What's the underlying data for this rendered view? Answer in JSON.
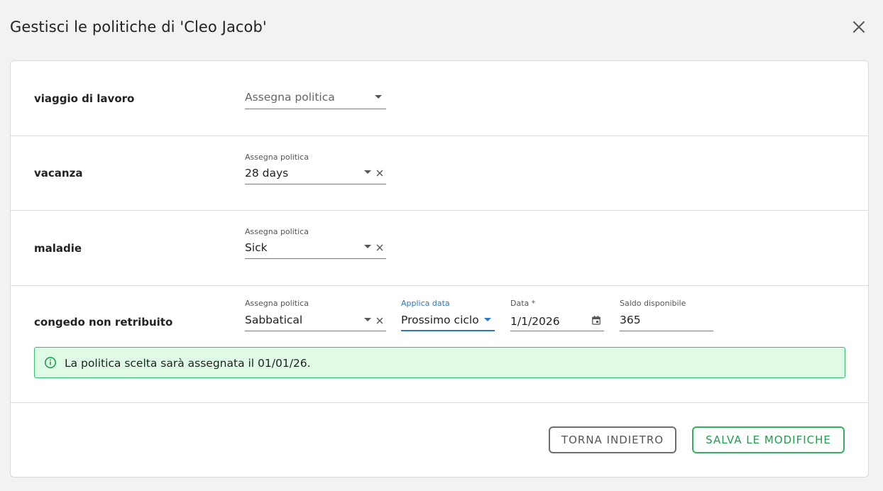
{
  "dialog": {
    "title": "Gestisci le politiche di 'Cleo Jacob'"
  },
  "rows": [
    {
      "label": "viaggio di lavoro",
      "policy_placeholder": "Assegna politica"
    },
    {
      "label": "vacanza",
      "policy_label": "Assegna politica",
      "policy_value": "28 days"
    },
    {
      "label": "maladie",
      "policy_label": "Assegna politica",
      "policy_value": "Sick"
    },
    {
      "label": "congedo non retribuito",
      "policy_label": "Assegna politica",
      "policy_value": "Sabbatical",
      "apply_label": "Applica data",
      "apply_value": "Prossimo ciclo",
      "date_label": "Data *",
      "date_value": "1/1/2026",
      "balance_label": "Saldo disponibile",
      "balance_value": "365"
    }
  ],
  "alert": {
    "text": "La politica scelta sarà assegnata il 01/01/26.",
    "icon": "info-icon"
  },
  "footer": {
    "back_label": "TORNA INDIETRO",
    "save_label": "SALVA LE MODIFICHE"
  },
  "colors": {
    "accent_blue": "#2a78c5",
    "success_green": "#2cb55a",
    "alert_bg": "#dffbe6"
  }
}
